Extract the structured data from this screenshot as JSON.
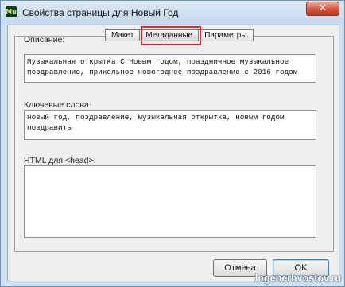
{
  "window": {
    "title": "Свойства страницы для Новый Год",
    "app_icon_text": "Mu",
    "close_glyph": "✕"
  },
  "tabs": [
    {
      "label": "Макет",
      "active": false
    },
    {
      "label": "Метаданные",
      "active": true
    },
    {
      "label": "Параметры",
      "active": false
    }
  ],
  "fields": {
    "description": {
      "label": "Описание:",
      "value": "Музыкальная открытка С Новым годом, праздничное музыкальное поздравление, прикольное новогоднее поздравление с 2016 годом"
    },
    "keywords": {
      "label": "Ключевые слова:",
      "value": "новый год, поздравление, музыкальная открытка, новым годом поздравить"
    },
    "head_html": {
      "label": "HTML для <head>:",
      "value": ""
    }
  },
  "buttons": {
    "cancel": "Отмена",
    "ok": "OK"
  },
  "watermark": "Ingenerhvostov.ru",
  "colors": {
    "highlight": "#e0262a",
    "titlebar": "#cfe0f1",
    "close_button": "#d2523a"
  }
}
